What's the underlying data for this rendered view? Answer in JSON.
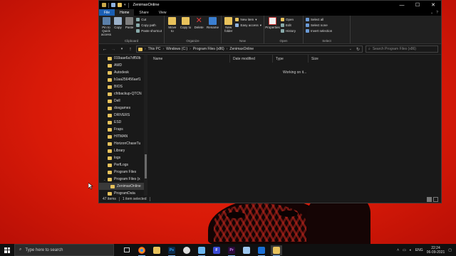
{
  "window": {
    "title": "ZenimaxOnline",
    "tabs": [
      {
        "label": "File"
      },
      {
        "label": "Home"
      },
      {
        "label": "Share"
      },
      {
        "label": "View"
      }
    ],
    "help_glyph": "?"
  },
  "ribbon": {
    "clipboard": {
      "label": "Clipboard",
      "pin": "Pin to Quick access",
      "copy": "Copy",
      "paste": "Paste",
      "cut": "Cut",
      "copy_path": "Copy path",
      "paste_shortcut": "Paste shortcut"
    },
    "organize": {
      "label": "Organize",
      "move_to": "Move to",
      "copy_to": "Copy to",
      "delete": "Delete",
      "rename": "Rename"
    },
    "new": {
      "label": "New",
      "new_folder": "New folder",
      "new_item": "New item",
      "easy_access": "Easy access"
    },
    "open": {
      "label": "Open",
      "properties": "Properties",
      "open": "Open",
      "edit": "Edit",
      "history": "History"
    },
    "select": {
      "label": "Select",
      "select_all": "Select all",
      "select_none": "Select none",
      "invert": "Invert selection"
    }
  },
  "address": {
    "crumbs": [
      "This PC",
      "Windows (C:)",
      "Program Files (x86)",
      "ZenimaxOnline"
    ],
    "search_placeholder": "Search Program Files (x86)"
  },
  "navpane": {
    "items": [
      {
        "label": "019aae6a7df50b"
      },
      {
        "label": "AMD"
      },
      {
        "label": "Autodesk"
      },
      {
        "label": "b1aa256456aef1"
      },
      {
        "label": "BIOS"
      },
      {
        "label": "cfribackup-QTCN"
      },
      {
        "label": "Dell"
      },
      {
        "label": "dosgames"
      },
      {
        "label": "DRIVERS"
      },
      {
        "label": "ESD"
      },
      {
        "label": "Fraps"
      },
      {
        "label": "HITMAN"
      },
      {
        "label": "HorizonChaseTu"
      },
      {
        "label": "Library"
      },
      {
        "label": "logs"
      },
      {
        "label": "PerfLogs"
      },
      {
        "label": "Program Files"
      },
      {
        "label": "Program Files (x"
      },
      {
        "label": "ZenimaxOnline"
      },
      {
        "label": "ProgramData"
      }
    ]
  },
  "columns": {
    "name": "Name",
    "date": "Date modified",
    "type": "Type",
    "size": "Size"
  },
  "content": {
    "working": "Working on it..."
  },
  "status": {
    "items": "47 items",
    "selected": "1 item selected"
  },
  "taskbar": {
    "search_placeholder": "Type here to search",
    "lang": "ENG",
    "time": "22:24",
    "date": "06-09-2021"
  }
}
